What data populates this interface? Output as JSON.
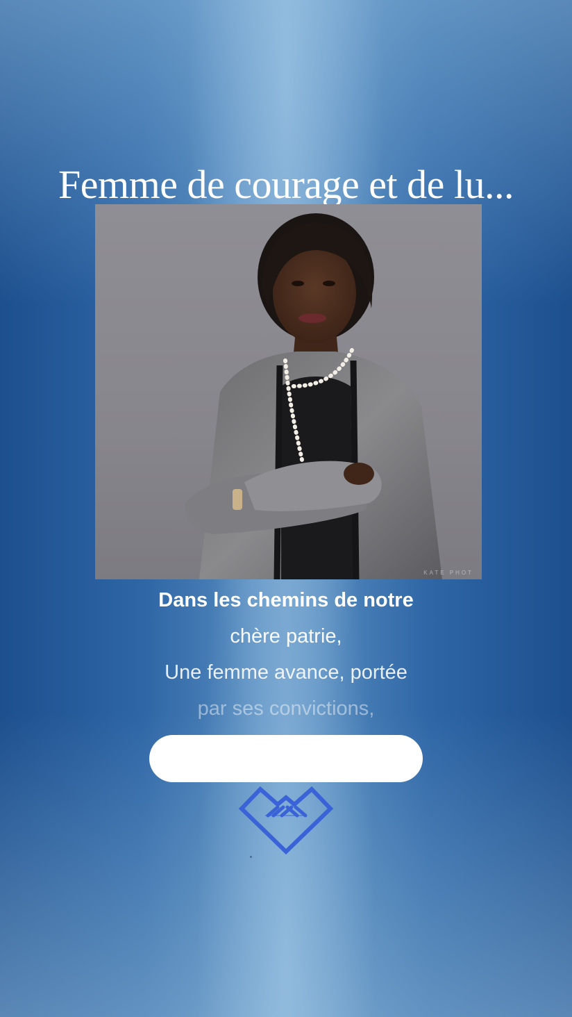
{
  "story": {
    "title": "Femme de courage et de lu...",
    "photo_watermark": "KATE PHOT",
    "poem_lines": [
      "Dans les chemins de notre",
      "chère patrie,",
      "Une femme avance, portée",
      "par ses convictions,"
    ],
    "button_label": ""
  },
  "colors": {
    "background_edge": "#1d4f8e",
    "background_center": "#5f94c4",
    "logo_stroke": "#3b63d8",
    "button": "#ffffff"
  },
  "icons": {
    "brand_logo": "diamond-heart-logo"
  }
}
